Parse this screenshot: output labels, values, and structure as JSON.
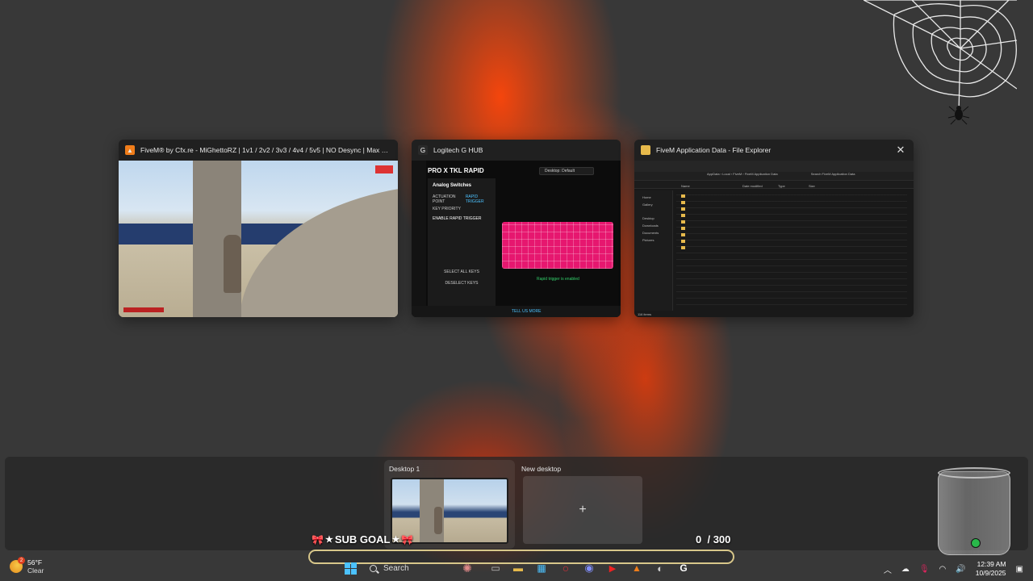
{
  "windows": [
    {
      "title": "FiveM® by Cfx.re - MiGhettoRZ | 1v1 / 2v2 / 3v3 / 4v4 / 5v5 | NO Desync | Max Perfor...",
      "icon": "fivem-icon",
      "icon_color": "#f07d1a"
    },
    {
      "title": "Logitech G HUB",
      "icon": "logitech-g-icon",
      "icon_color": "#ffffff",
      "app": {
        "device_name": "PRO X TKL RAPID",
        "profile": "Desktop: Default",
        "panel_title": "Analog Switches",
        "tabs": [
          "ACTUATION POINT",
          "RAPID TRIGGER",
          "KEY PRIORITY"
        ],
        "toggle_label": "ENABLE RAPID TRIGGER",
        "select_all": "SELECT ALL KEYS",
        "deselect_keys": "DESELECT KEYS",
        "status": "Rapid trigger is enabled",
        "tell_more": "TELL US MORE",
        "keyboard_color": "#e6176f"
      }
    },
    {
      "title": "FiveM Application Data - File Explorer",
      "icon": "folder-icon",
      "icon_color": "#e6b94b",
      "app": {
        "breadcrumb": [
          "AppData",
          "Local",
          "FiveM",
          "FiveM Application Data"
        ],
        "search_placeholder": "Search FiveM Application Data",
        "columns": [
          "Name",
          "Date modified",
          "Type",
          "Size"
        ],
        "nav_items": [
          "Home",
          "Gallery",
          "Desktop",
          "Downloads",
          "Documents",
          "Pictures"
        ],
        "status": "116 items"
      }
    }
  ],
  "desktops": {
    "current_label": "Desktop 1",
    "new_label": "New desktop",
    "new_icon": "+"
  },
  "overlay": {
    "sub_goal_label": "SUB GOAL",
    "sub_goal_current": "0",
    "sub_goal_target": "/ 300",
    "sub_goal_progress": 0,
    "bar_color": "#d8c78a"
  },
  "taskbar": {
    "weather_temp": "56°F",
    "weather_desc": "Clear",
    "weather_badge": "2",
    "search_label": "Search",
    "time": "12:39 AM",
    "date": "10/9/2025"
  }
}
